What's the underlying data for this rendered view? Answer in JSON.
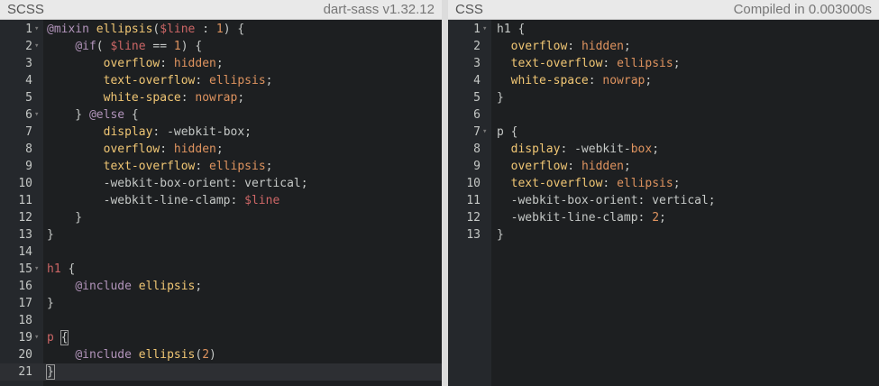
{
  "left_pane": {
    "title": "SCSS",
    "meta": "dart-sass v1.32.12",
    "active_line": 21,
    "lines": [
      {
        "n": "1",
        "fold": true,
        "tokens": [
          [
            "kw",
            "@mixin"
          ],
          [
            "txt",
            " "
          ],
          [
            "fn",
            "ellipsis"
          ],
          [
            "txt",
            "("
          ],
          [
            "var",
            "$line"
          ],
          [
            "txt",
            " : "
          ],
          [
            "num",
            "1"
          ],
          [
            "txt",
            ") {"
          ]
        ]
      },
      {
        "n": "2",
        "fold": true,
        "tokens": [
          [
            "txt",
            "    "
          ],
          [
            "kw",
            "@if"
          ],
          [
            "txt",
            "( "
          ],
          [
            "var",
            "$line"
          ],
          [
            "txt",
            " == "
          ],
          [
            "num",
            "1"
          ],
          [
            "txt",
            ") {"
          ]
        ]
      },
      {
        "n": "3",
        "tokens": [
          [
            "txt",
            "        "
          ],
          [
            "prop",
            "overflow"
          ],
          [
            "txt",
            ": "
          ],
          [
            "val",
            "hidden"
          ],
          [
            "txt",
            ";"
          ]
        ]
      },
      {
        "n": "4",
        "tokens": [
          [
            "txt",
            "        "
          ],
          [
            "prop",
            "text-overflow"
          ],
          [
            "txt",
            ": "
          ],
          [
            "val",
            "ellipsis"
          ],
          [
            "txt",
            ";"
          ]
        ]
      },
      {
        "n": "5",
        "tokens": [
          [
            "txt",
            "        "
          ],
          [
            "prop",
            "white-space"
          ],
          [
            "txt",
            ": "
          ],
          [
            "val",
            "nowrap"
          ],
          [
            "txt",
            ";"
          ]
        ]
      },
      {
        "n": "6",
        "fold": true,
        "tokens": [
          [
            "txt",
            "    } "
          ],
          [
            "kw",
            "@else"
          ],
          [
            "txt",
            " {"
          ]
        ]
      },
      {
        "n": "7",
        "tokens": [
          [
            "txt",
            "        "
          ],
          [
            "prop",
            "display"
          ],
          [
            "txt",
            ": -webkit-box;"
          ]
        ]
      },
      {
        "n": "8",
        "tokens": [
          [
            "txt",
            "        "
          ],
          [
            "prop",
            "overflow"
          ],
          [
            "txt",
            ": "
          ],
          [
            "val",
            "hidden"
          ],
          [
            "txt",
            ";"
          ]
        ]
      },
      {
        "n": "9",
        "tokens": [
          [
            "txt",
            "        "
          ],
          [
            "prop",
            "text-overflow"
          ],
          [
            "txt",
            ": "
          ],
          [
            "val",
            "ellipsis"
          ],
          [
            "txt",
            ";"
          ]
        ]
      },
      {
        "n": "10",
        "tokens": [
          [
            "txt",
            "        -webkit-box-orient: vertical;"
          ]
        ]
      },
      {
        "n": "11",
        "tokens": [
          [
            "txt",
            "        -webkit-line-clamp: "
          ],
          [
            "var",
            "$line"
          ]
        ]
      },
      {
        "n": "12",
        "tokens": [
          [
            "txt",
            "    }"
          ]
        ]
      },
      {
        "n": "13",
        "tokens": [
          [
            "txt",
            "}"
          ]
        ]
      },
      {
        "n": "14",
        "tokens": []
      },
      {
        "n": "15",
        "fold": true,
        "tokens": [
          [
            "sel",
            "h1"
          ],
          [
            "txt",
            " {"
          ]
        ]
      },
      {
        "n": "16",
        "tokens": [
          [
            "txt",
            "    "
          ],
          [
            "kw",
            "@include"
          ],
          [
            "txt",
            " "
          ],
          [
            "fn",
            "ellipsis"
          ],
          [
            "txt",
            ";"
          ]
        ]
      },
      {
        "n": "17",
        "tokens": [
          [
            "txt",
            "}"
          ]
        ]
      },
      {
        "n": "18",
        "tokens": []
      },
      {
        "n": "19",
        "fold": true,
        "tokens": [
          [
            "sel",
            "p"
          ],
          [
            "txt",
            " "
          ],
          [
            "bracket",
            "{"
          ]
        ]
      },
      {
        "n": "20",
        "tokens": [
          [
            "txt",
            "    "
          ],
          [
            "kw",
            "@include"
          ],
          [
            "txt",
            " "
          ],
          [
            "fn",
            "ellipsis"
          ],
          [
            "txt",
            "("
          ],
          [
            "num",
            "2"
          ],
          [
            "txt",
            ")"
          ]
        ]
      },
      {
        "n": "21",
        "tokens": [
          [
            "bracket",
            "}"
          ],
          [
            "cursor",
            ""
          ]
        ]
      }
    ]
  },
  "right_pane": {
    "title": "CSS",
    "meta": "Compiled in 0.003000s",
    "lines": [
      {
        "n": "1",
        "fold": true,
        "tokens": [
          [
            "txt",
            "h1 {"
          ]
        ]
      },
      {
        "n": "2",
        "tokens": [
          [
            "txt",
            "  "
          ],
          [
            "prop",
            "overflow"
          ],
          [
            "txt",
            ": "
          ],
          [
            "val",
            "hidden"
          ],
          [
            "txt",
            ";"
          ]
        ]
      },
      {
        "n": "3",
        "tokens": [
          [
            "txt",
            "  "
          ],
          [
            "prop",
            "text-overflow"
          ],
          [
            "txt",
            ": "
          ],
          [
            "val",
            "ellipsis"
          ],
          [
            "txt",
            ";"
          ]
        ]
      },
      {
        "n": "4",
        "tokens": [
          [
            "txt",
            "  "
          ],
          [
            "prop",
            "white-space"
          ],
          [
            "txt",
            ": "
          ],
          [
            "val",
            "nowrap"
          ],
          [
            "txt",
            ";"
          ]
        ]
      },
      {
        "n": "5",
        "tokens": [
          [
            "txt",
            "}"
          ]
        ]
      },
      {
        "n": "6",
        "tokens": []
      },
      {
        "n": "7",
        "fold": true,
        "tokens": [
          [
            "txt",
            "p {"
          ]
        ]
      },
      {
        "n": "8",
        "tokens": [
          [
            "txt",
            "  "
          ],
          [
            "prop",
            "display"
          ],
          [
            "txt",
            ": -webkit-"
          ],
          [
            "val",
            "box"
          ],
          [
            "txt",
            ";"
          ]
        ]
      },
      {
        "n": "9",
        "tokens": [
          [
            "txt",
            "  "
          ],
          [
            "prop",
            "overflow"
          ],
          [
            "txt",
            ": "
          ],
          [
            "val",
            "hidden"
          ],
          [
            "txt",
            ";"
          ]
        ]
      },
      {
        "n": "10",
        "tokens": [
          [
            "txt",
            "  "
          ],
          [
            "prop",
            "text-overflow"
          ],
          [
            "txt",
            ": "
          ],
          [
            "val",
            "ellipsis"
          ],
          [
            "txt",
            ";"
          ]
        ]
      },
      {
        "n": "11",
        "tokens": [
          [
            "txt",
            "  -webkit-box-orient: vertical;"
          ]
        ]
      },
      {
        "n": "12",
        "tokens": [
          [
            "txt",
            "  -webkit-line-clamp: "
          ],
          [
            "num",
            "2"
          ],
          [
            "txt",
            ";"
          ]
        ]
      },
      {
        "n": "13",
        "tokens": [
          [
            "txt",
            "}"
          ]
        ]
      }
    ]
  },
  "icons": {
    "fold_marker": "chevron-down-icon"
  },
  "colors": {
    "background": "#1d1f21",
    "gutter": "#25282c",
    "keyword": "#b294bb",
    "function": "#f0c674",
    "variable": "#cc6666",
    "number": "#de935f",
    "text": "#c5c8c6"
  }
}
